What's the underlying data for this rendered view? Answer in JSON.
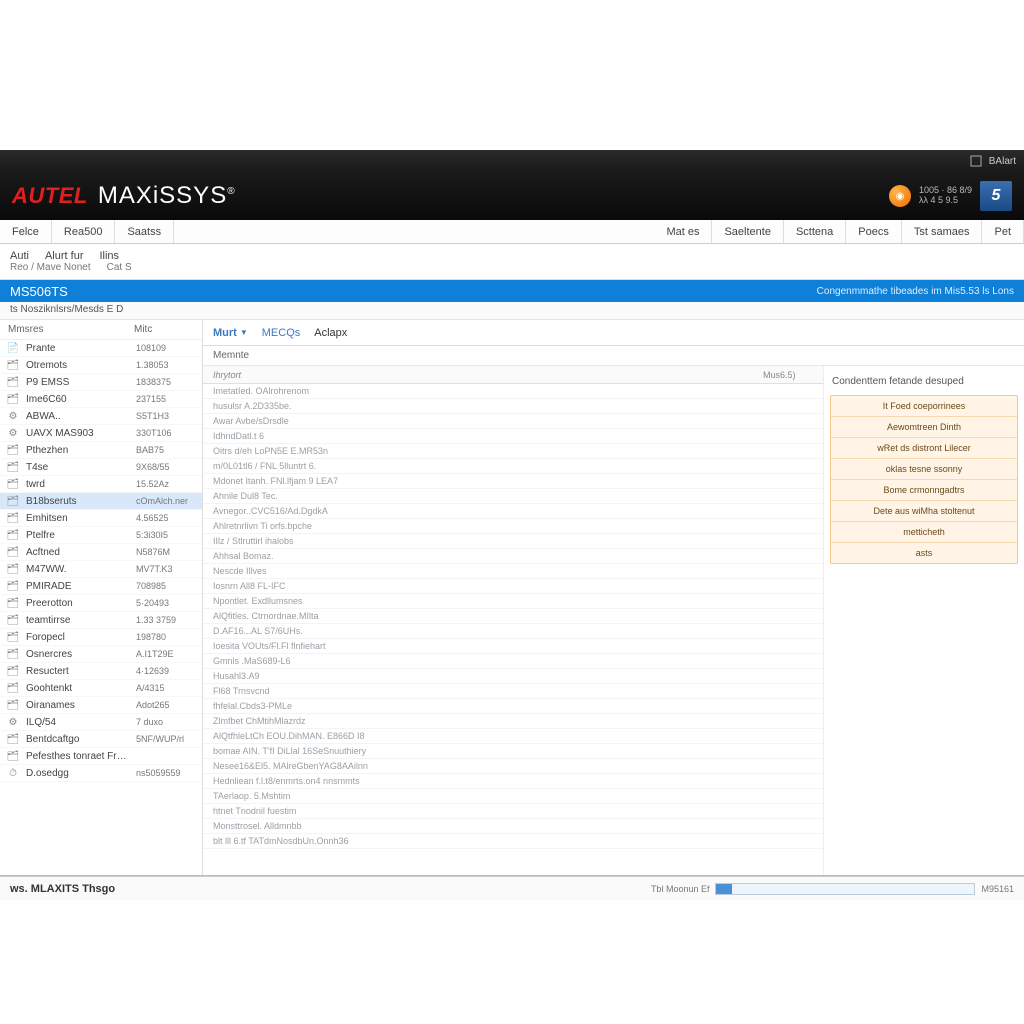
{
  "titlebar": {
    "alert": "BAlart"
  },
  "brand": {
    "autel": "AUTEL",
    "maxisys": "MAXiSSYS",
    "reg": "®",
    "smalltext1": "1005 · 86 8/9",
    "smalltext2": "λλ 4 5 9.5",
    "bluebox": "5"
  },
  "topTabs": {
    "left": [
      "Felce",
      "Rea500",
      "Saatss"
    ],
    "right": [
      "Mat es",
      "Saeltente",
      "Scttena",
      "Poecs",
      "Tst samaes",
      "Pet"
    ]
  },
  "subbar": {
    "row1": [
      "Auti",
      "Alurt fur",
      "Ilins"
    ],
    "row2": [
      "Reo / Mave Nonet",
      "Cat S"
    ]
  },
  "bluebar": {
    "title": "MS506TS",
    "right": "Congenmmathe tibeades im Mis5.53 ls Lons"
  },
  "breadcrumb": "ts Nosziknlsrs/Mesds E D",
  "sidebar": {
    "header": {
      "col1": "Mmsres",
      "col2": "Mitc"
    },
    "items": [
      {
        "label": "Prante",
        "value": "108109"
      },
      {
        "label": "Otremots",
        "value": "1.38053"
      },
      {
        "label": "P9 EMSS",
        "value": "1838375"
      },
      {
        "label": "Ime6C60",
        "value": "237155"
      },
      {
        "label": "ABWA..",
        "value": "S5T1H3"
      },
      {
        "label": "UAVX MAS903",
        "value": "330T106"
      },
      {
        "label": "Pthezhen",
        "value": "BAB75"
      },
      {
        "label": "T4se",
        "value": "9X68/55"
      },
      {
        "label": "twrd",
        "value": "15.52Az"
      },
      {
        "label": "B18bseruts",
        "value": "cOmAlch.ner",
        "selected": true
      },
      {
        "label": "Emhitsen",
        "value": "4.56525"
      },
      {
        "label": "Ptelfre",
        "value": "5:3i30I5"
      },
      {
        "label": "Acftned",
        "value": "N5876M"
      },
      {
        "label": "M47WW.",
        "value": "MV7T.K3"
      },
      {
        "label": "PMIRADE",
        "value": "708985"
      },
      {
        "label": "Preerotton",
        "value": "5·20493"
      },
      {
        "label": "teamtirrse",
        "value": "1.33 3759"
      },
      {
        "label": "Foropecl",
        "value": "198780"
      },
      {
        "label": "Osnercres",
        "value": "A.I1T29E"
      },
      {
        "label": "Resuctert",
        "value": "4·12639"
      },
      {
        "label": "Goohtenkt",
        "value": "A/4315"
      },
      {
        "label": "Oiranames",
        "value": "Adot265"
      },
      {
        "label": "ILQ/54",
        "value": "7 duxo"
      },
      {
        "label": "Bentdcaftgo",
        "value": "5NF/WUP/rl"
      },
      {
        "label": "Pefesthes tonraet Frnce",
        "value": ""
      },
      {
        "label": "D.osedgg",
        "value": "ns5059559"
      }
    ]
  },
  "contentTabs": {
    "main": "Murt",
    "meta": "MECQs",
    "adapt": "Aclapx"
  },
  "contentSubhead": "Memnte",
  "gridHead": {
    "col1": "Ihrytort",
    "col2": "Mus6.5)"
  },
  "gridRows": [
    "ImetatIed. OAlrohrenom",
    "husulsr A.2D335be.",
    "Awar Avbe/sDrsdle",
    "IdhndDatl.t 6",
    "Oitrs d/eh LoPN5E E.MR53n",
    "m/0L01tl6 / FNL 5lluntrt 6.",
    "Mdonet Itanh. FNl.lfjam 9 LEA7",
    "Ahnile Dul8 Tec.",
    "Avnegor..CVC516/Ad.DgdkA",
    "Ahlretnrlivn Ti orfs.bpche",
    "IIlz / Stlruttirl ihalobs",
    "Ahhsal Bomaz.",
    "Nescde Illves",
    "Iosnrn All8 FL-IFC",
    "Npontlet. Exdllumsnes",
    "AlQfitles. Ctrnordnae.MIlta",
    "D.AF16...AL S7/6UHs.",
    "Ioesita VOUts/Fl.Fl flnfiehart",
    "Gmnls .MaS689-L6",
    "Husahl3.A9",
    "Fl68 Trnsvcnd",
    "fhfelal.Cbds3-PMLe",
    "Zlmfbet ChMtihMlazrdz",
    "AlQtfhleLtCh EOU.DihMAN. E866D I8",
    "bomae AIN. T'fI DiLlal 16SeSnuuthiery",
    "Nesee16&El5. MAlreGbenYAG8AAilnn",
    "Hednliean f.l.t8/enmrts.on4 nnsmmts",
    "TAerlaop. 5.Mshtim",
    "htnet Tnodnil fuestim",
    "Monsttrosel. Alldmnbb",
    "blt lll 6.tf TATdmNosdbUn.Onnh36"
  ],
  "gridRightVal": "M95161",
  "sidepanel": {
    "head": "Condenttem fetande desuped",
    "items": [
      "It Foed coeporrinees",
      "Aewomtreen Dinth",
      "wRet ds distront Lilecer",
      "oklas tesne ssonny",
      "Bome crmonngadtrs",
      "Dete aus wiMha stoltenut",
      "metticheth",
      "asts"
    ]
  },
  "statusbar": {
    "left": "ws.  MLAXITS Thsgo",
    "progressLabel": "Tbl Moonun Ef"
  }
}
